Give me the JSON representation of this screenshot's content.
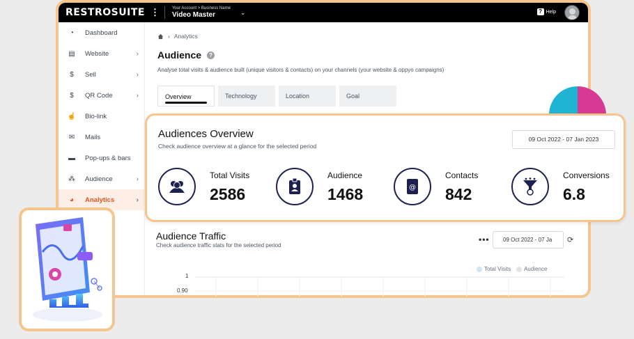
{
  "topbar": {
    "brand": "RESTROSUITE",
    "account_sub": "Your Account > Business Name",
    "account_name": "Video Master",
    "help_label": "Help"
  },
  "sidebar": {
    "items": [
      {
        "label": "Dashboard",
        "icon": "dashboard-icon",
        "chevron": false,
        "active": false
      },
      {
        "label": "Website",
        "icon": "website-icon",
        "chevron": true,
        "active": false
      },
      {
        "label": "Sell",
        "icon": "dollar-icon",
        "chevron": true,
        "active": false
      },
      {
        "label": "QR Code",
        "icon": "dollar-icon",
        "chevron": true,
        "active": false
      },
      {
        "label": "Bio-link",
        "icon": "bio-link-icon",
        "chevron": false,
        "active": false
      },
      {
        "label": "Mails",
        "icon": "mail-icon",
        "chevron": false,
        "active": false
      },
      {
        "label": "Pop-ups & bars",
        "icon": "popup-icon",
        "chevron": false,
        "active": false
      },
      {
        "label": "Audience",
        "icon": "audience-icon",
        "chevron": true,
        "active": false
      },
      {
        "label": "Analytics",
        "icon": "analytics-icon",
        "chevron": true,
        "active": true
      }
    ]
  },
  "breadcrumb": {
    "home_icon": "home-icon",
    "current": "Analytics"
  },
  "page": {
    "title": "Audience",
    "subtitle": "Analyse total visits & audience built (unique visitors & contacts) on your channels (your website & oppyo campaigns)"
  },
  "tabs": [
    {
      "label": "Overview",
      "active": true
    },
    {
      "label": "Technology",
      "active": false
    },
    {
      "label": "Location",
      "active": false
    },
    {
      "label": "Goal",
      "active": false
    }
  ],
  "overview": {
    "title": "Audiences Overview",
    "subtitle": "Check audience overview at a glance for the selected period",
    "date_range": "09 Oct 2022 - 07 Jan 2023",
    "stats": [
      {
        "label": "Total Visits",
        "value": "2586",
        "icon": "users-icon"
      },
      {
        "label": "Audience",
        "value": "1468",
        "icon": "id-badge-icon"
      },
      {
        "label": "Contacts",
        "value": "842",
        "icon": "contact-book-icon"
      },
      {
        "label": "Conversions",
        "value": "6.8",
        "icon": "funnel-icon"
      }
    ]
  },
  "traffic": {
    "title": "Audience Traffic",
    "subtitle": "Check audience traffic stats for the selected period",
    "date_range": "09 Oct 2022 - 07 Ja",
    "more_label": "•••",
    "legend": [
      {
        "name": "Total Visits",
        "color": "#cfe7f5"
      },
      {
        "name": "Audience",
        "color": "#e3e3e6"
      }
    ]
  },
  "chart_data": {
    "type": "line",
    "yticks": [
      "1",
      "0.90"
    ],
    "series": [
      {
        "name": "Total Visits",
        "color": "#cfe7f5"
      },
      {
        "name": "Audience",
        "color": "#e3e3e6"
      }
    ]
  },
  "colors": {
    "accent": "#e8531e",
    "frame": "#f6c48d",
    "icon_navy": "#1d2150"
  }
}
